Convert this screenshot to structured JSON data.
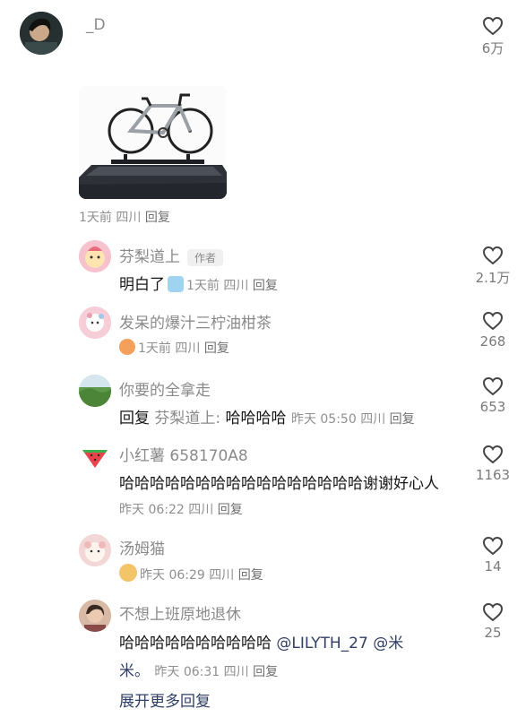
{
  "top_comment": {
    "username": "_D",
    "likes": "6万",
    "meta": {
      "time": "1天前",
      "location": "四川",
      "reply": "回复"
    }
  },
  "replies": [
    {
      "username": "芬梨道上",
      "badge": "作者",
      "text": "明白了",
      "meta": {
        "time": "1天前",
        "location": "四川",
        "reply": "回复"
      },
      "likes": "2.1万"
    },
    {
      "username": "发呆的爆汁三柠油柑茶",
      "meta": {
        "time": "1天前",
        "location": "四川",
        "reply": "回复"
      },
      "likes": "268"
    },
    {
      "username": "你要的全拿走",
      "text_prefix": "回复",
      "reply_to": "芬梨道上:",
      "text": "哈哈哈哈",
      "meta": {
        "time": "昨天 05:50",
        "location": "四川",
        "reply": "回复"
      },
      "likes": "653"
    },
    {
      "username": "小红薯 658170A8",
      "text": "哈哈哈哈哈哈哈哈哈哈哈哈哈哈哈哈谢谢好心人",
      "meta": {
        "time": "昨天 06:22",
        "location": "四川",
        "reply": "回复"
      },
      "likes": "1163"
    },
    {
      "username": "汤姆猫",
      "meta": {
        "time": "昨天 06:29",
        "location": "四川",
        "reply": "回复"
      },
      "likes": "14"
    },
    {
      "username": "不想上班原地退休",
      "text": "哈哈哈哈哈哈哈哈哈哈",
      "mention1": "@LILYTH_27",
      "mention2_a": "@米",
      "mention2_b": "米。",
      "meta": {
        "time": "昨天 06:31",
        "location": "四川",
        "reply": "回复"
      },
      "likes": "25"
    }
  ],
  "expand_more": "展开更多回复",
  "colors": {
    "username": "#8a8a8a",
    "meta": "#8f8f8f",
    "link": "#2f3f66",
    "heart": "#444444"
  },
  "icons": {
    "like": "heart-outline-icon"
  }
}
